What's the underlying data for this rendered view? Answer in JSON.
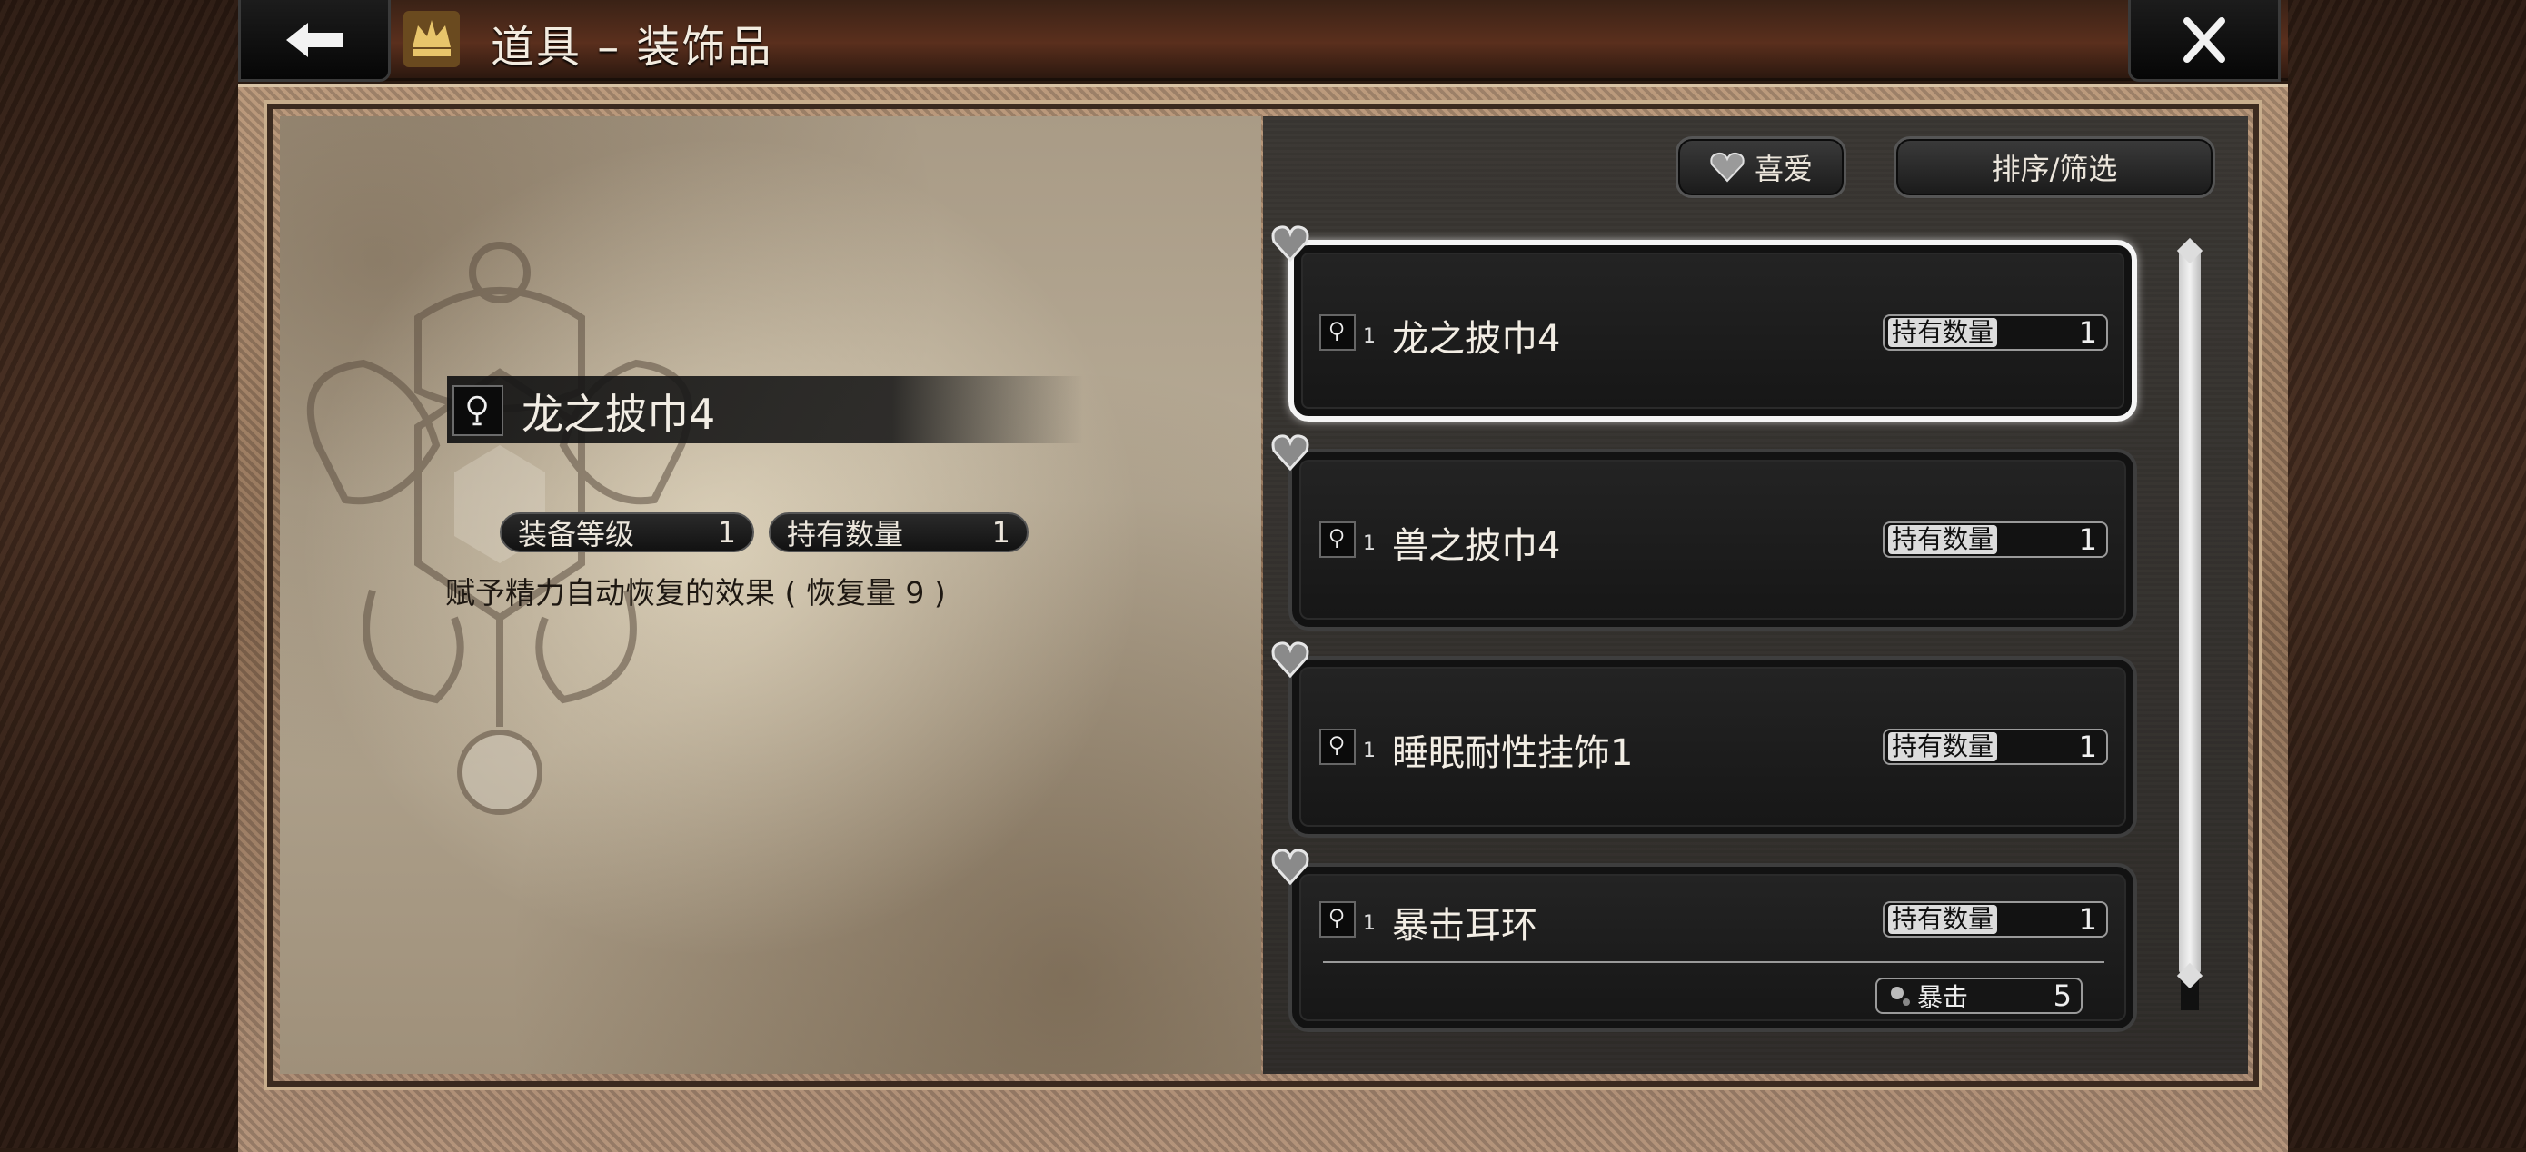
{
  "header": {
    "title": "道具 – 装饰品",
    "back_icon": "arrow-left-icon",
    "close_icon": "close-icon",
    "title_icon": "accessory-crown-icon"
  },
  "detail": {
    "item_name": "龙之披巾4",
    "item_icon": "accessory-icon",
    "equip_level_label": "装备等级",
    "equip_level_value": "1",
    "owned_label": "持有数量",
    "owned_value": "1",
    "description": "赋予精力自动恢复的效果 ( 恢复量 9 )"
  },
  "toolbar": {
    "favorite_label": "喜爱",
    "sort_filter_label": "排序/筛选"
  },
  "list": {
    "items": [
      {
        "name": "龙之披巾4",
        "level": "1",
        "qty_label": "持有数量",
        "qty": "1"
      },
      {
        "name": "兽之披巾4",
        "level": "1",
        "qty_label": "持有数量",
        "qty": "1"
      },
      {
        "name": "睡眠耐性挂饰1",
        "level": "1",
        "qty_label": "持有数量",
        "qty": "1"
      },
      {
        "name": "暴击耳环",
        "level": "1",
        "qty_label": "持有数量",
        "qty": "1",
        "stat_label": "暴击",
        "stat_value": "5"
      }
    ]
  },
  "colors": {
    "selected_border": "#f5f5f5",
    "panel_dark": "#2f2c29",
    "parchment": "#b7ab96"
  }
}
